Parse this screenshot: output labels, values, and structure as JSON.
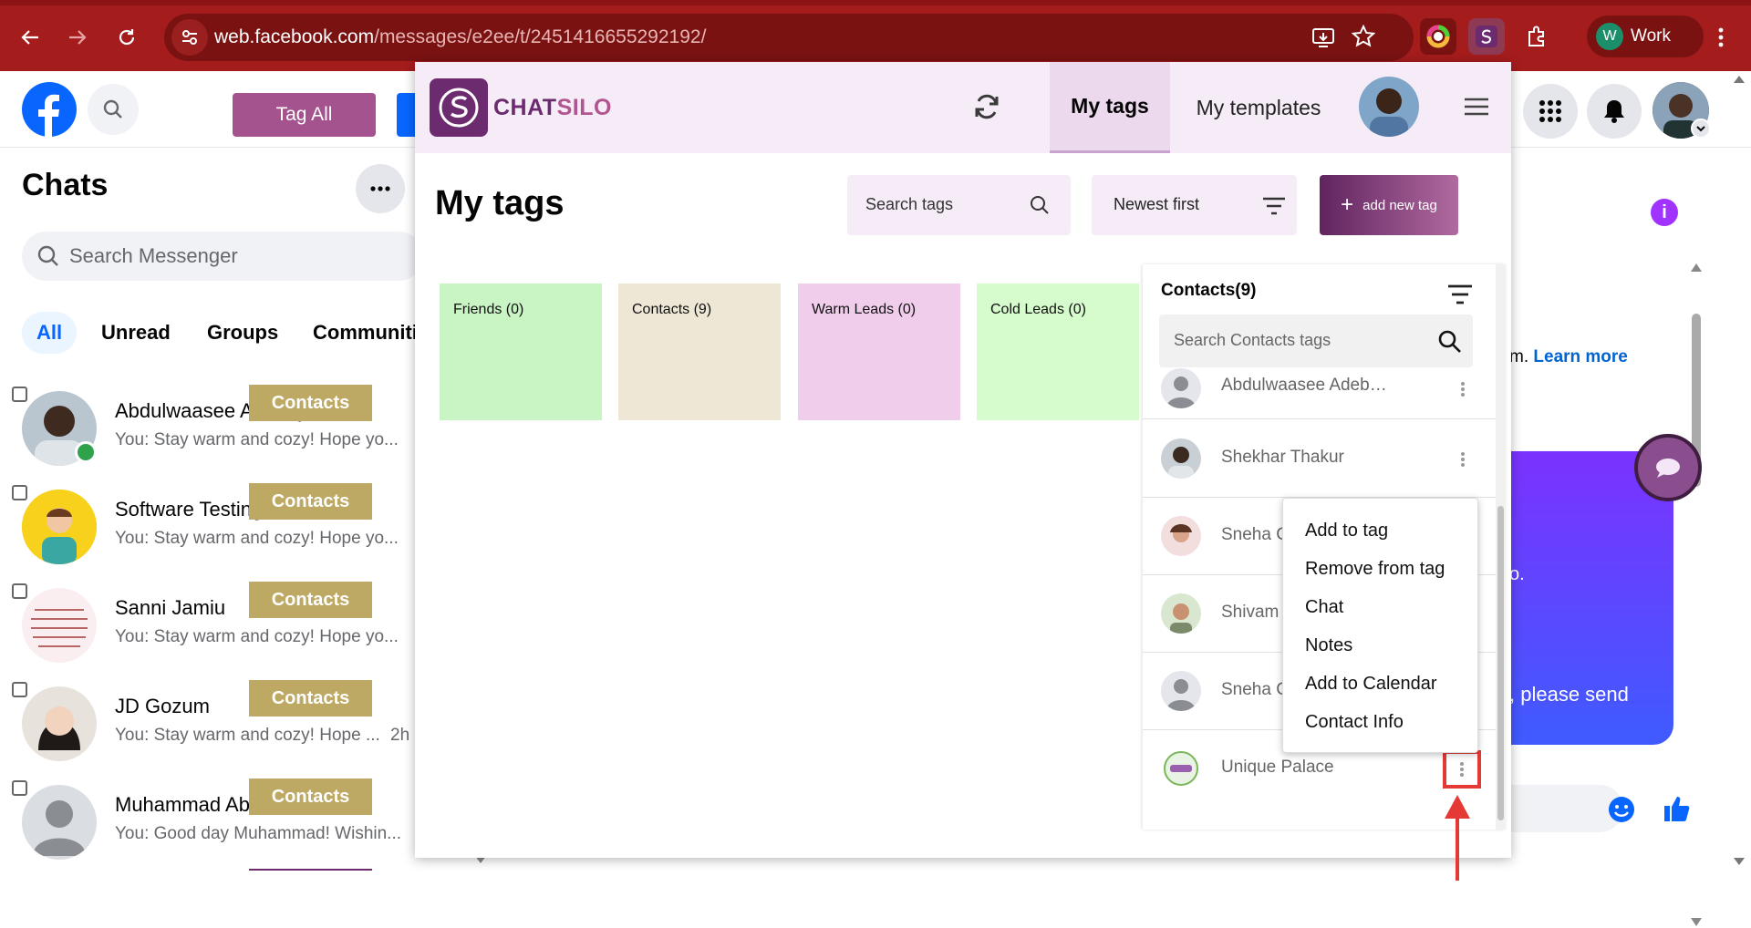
{
  "browser": {
    "url_host": "web.facebook.com",
    "url_path": "/messages/e2ee/t/2451416655292192/",
    "profile_initial": "W",
    "profile_label": "Work"
  },
  "facebook": {
    "tag_all_label": "Tag All",
    "chats_title": "Chats",
    "search_placeholder": "Search Messenger",
    "filters": [
      "All",
      "Unread",
      "Groups",
      "Communiti"
    ],
    "chats": [
      {
        "name": "Abdulwaasee Adebayo",
        "preview": "You: Stay warm and cozy! Hope yo...",
        "tag": "Contacts",
        "time": "·"
      },
      {
        "name": "Software Testing Hub",
        "preview": "You: Stay warm and cozy! Hope yo...",
        "tag": "Contacts",
        "time": "·"
      },
      {
        "name": "Sanni Jamiu",
        "preview": "You: Stay warm and cozy! Hope yo...",
        "tag": "Contacts",
        "time": "·"
      },
      {
        "name": "JD Gozum",
        "preview": "You: Stay warm and cozy! Hope ...",
        "tag": "Contacts",
        "time": "2h"
      },
      {
        "name": "Muhammad Abdulmalik",
        "preview": "You: Good day Muhammad! Wishin...",
        "tag": "Contacts",
        "time": ""
      }
    ],
    "right": {
      "learn_more_prefix": "m.",
      "learn_more": "Learn more",
      "bubble_text_1": "o.",
      "bubble_text_2": ", please send"
    }
  },
  "chatsilo": {
    "brand_a": "CHAT",
    "brand_b": "SILO",
    "tab_my_tags": "My tags",
    "tab_my_templates": "My templates",
    "page_title": "My tags",
    "search_tags_placeholder": "Search tags",
    "sort_label": "Newest first",
    "add_new_tag": "add new tag",
    "tags": [
      {
        "label": "Friends (0)",
        "color": "#c9f5c4"
      },
      {
        "label": "Contacts (9)",
        "color": "#efe7d6"
      },
      {
        "label": "Warm Leads (0)",
        "color": "#f0cdeb"
      },
      {
        "label": "Cold Leads (0)",
        "color": "#d6fbcd"
      }
    ],
    "contacts_header": "Contacts(9)",
    "contacts_search_placeholder": "Search Contacts tags",
    "contacts": [
      "Abdulwaasee Adeb…",
      "Shekhar Thakur",
      "Sneha C",
      "Shivam",
      "Sneha C",
      "Unique Palace"
    ],
    "context_menu": [
      "Add to tag",
      "Remove from tag",
      "Chat",
      "Notes",
      "Add to Calendar",
      "Contact Info"
    ]
  }
}
